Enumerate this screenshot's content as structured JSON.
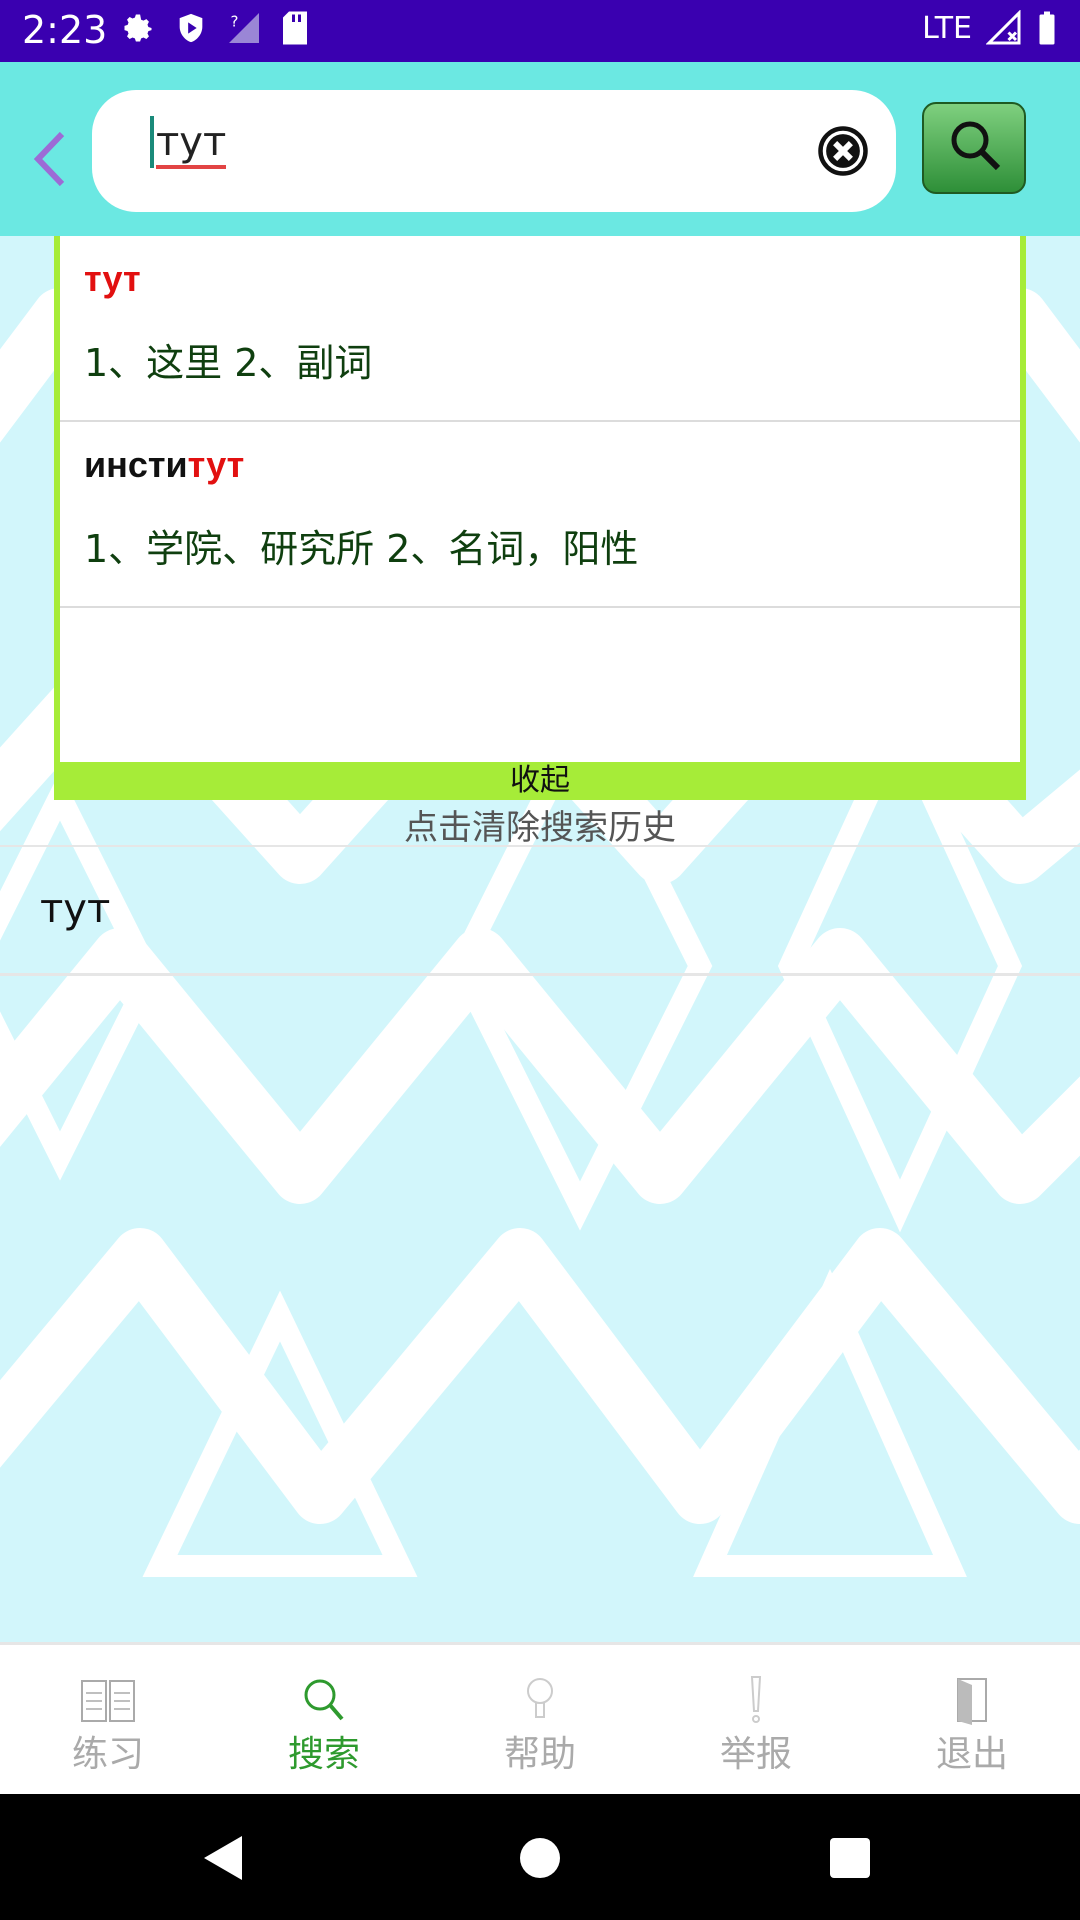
{
  "status_bar": {
    "time": "2:23",
    "network": "LTE"
  },
  "search": {
    "query": "тут"
  },
  "suggestions": [
    {
      "word_prefix": "",
      "word_match": "тут",
      "definition": "1、这里 2、副词"
    },
    {
      "word_prefix": "инсти",
      "word_match": "тут",
      "definition": "1、学院、研究所 2、名词，阳性"
    }
  ],
  "collapse_label": "收起",
  "clear_history_label": "点击清除搜索历史",
  "history": [
    {
      "word": "тут"
    }
  ],
  "nav": {
    "items": [
      {
        "label": "练习",
        "icon": "book-icon"
      },
      {
        "label": "搜索",
        "icon": "search-icon",
        "active": true
      },
      {
        "label": "帮助",
        "icon": "lightbulb-icon"
      },
      {
        "label": "举报",
        "icon": "exclamation-icon"
      },
      {
        "label": "退出",
        "icon": "exit-door-icon"
      }
    ]
  },
  "colors": {
    "status_bar": "#3a00b0",
    "top_bar": "#6be8e2",
    "accent_green": "#2e9a2e",
    "highlight_red": "#e21010",
    "panel_border": "#a6ec38"
  }
}
